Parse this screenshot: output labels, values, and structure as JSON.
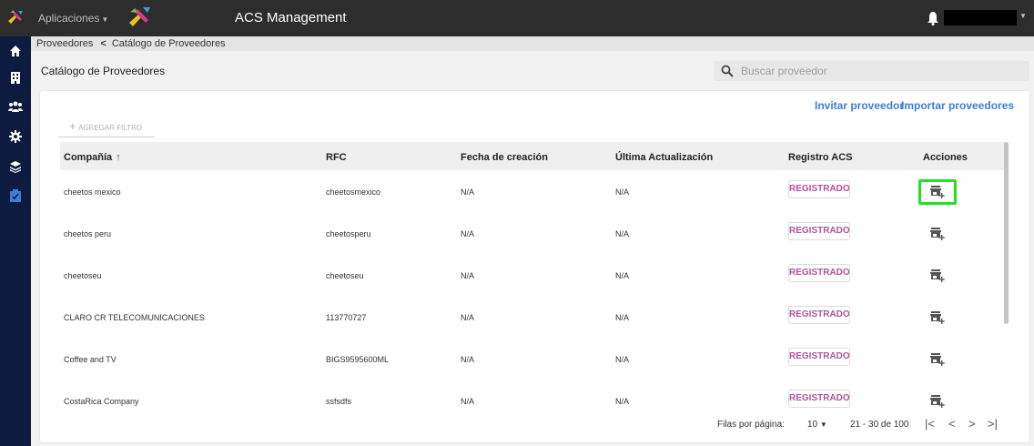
{
  "header": {
    "apps_menu_label": "Aplicaciones",
    "brand_logo_text": "axosnet",
    "app_title": "ACS Management"
  },
  "sidebar": {
    "items": [
      {
        "icon": "home-icon"
      },
      {
        "icon": "building-icon"
      },
      {
        "icon": "users-icon"
      },
      {
        "icon": "gear-icon"
      },
      {
        "icon": "layers-icon"
      },
      {
        "icon": "clipboard-check-icon",
        "active": true
      }
    ],
    "active_color": "#3d7fd6"
  },
  "breadcrumb": {
    "items": [
      "Proveedores",
      "Catálogo de Proveedores"
    ]
  },
  "page": {
    "title": "Catálogo de Proveedores"
  },
  "search": {
    "placeholder": "Buscar proveedor"
  },
  "actions": {
    "invite_label": "Invitar proveedor",
    "import_label": "Importar proveedores",
    "add_filter_label": "AGREGAR FILTRO"
  },
  "table": {
    "columns": [
      "Compañía",
      "RFC",
      "Fecha de creación",
      "Última Actualización",
      "Registro ACS",
      "Acciones"
    ],
    "sort_indicator": "↑",
    "rows": [
      {
        "company": "cheetos mexico",
        "rfc": "cheetosmexico",
        "created": "N/A",
        "updated": "N/A",
        "status": "REGISTRADO"
      },
      {
        "company": "cheetos peru",
        "rfc": "cheetosperu",
        "created": "N/A",
        "updated": "N/A",
        "status": "REGISTRADO"
      },
      {
        "company": "cheetoseu",
        "rfc": "cheetoseu",
        "created": "N/A",
        "updated": "N/A",
        "status": "REGISTRADO"
      },
      {
        "company": "CLARO CR TELECOMUNICACIONES",
        "rfc": "113770727",
        "created": "N/A",
        "updated": "N/A",
        "status": "REGISTRADO"
      },
      {
        "company": "Coffee and TV",
        "rfc": "BIGS9595600ML",
        "created": "N/A",
        "updated": "N/A",
        "status": "REGISTRADO"
      },
      {
        "company": "CostaRica Company",
        "rfc": "ssfsdfs",
        "created": "N/A",
        "updated": "N/A",
        "status": "REGISTRADO"
      }
    ],
    "status_color": "#b0549a",
    "action_icon": "store-add-icon"
  },
  "pagination": {
    "rows_per_page_label": "Filas por página:",
    "rows_per_page_value": "10",
    "range_label": "21 - 30 de 100",
    "first_label": "|<",
    "prev_label": "<",
    "next_label": ">",
    "last_label": ">|"
  },
  "colors": {
    "topbar": "#2d2d2d",
    "sidebar": "#0c1b3f",
    "link": "#3d7fd6",
    "highlight": "#22e022"
  }
}
